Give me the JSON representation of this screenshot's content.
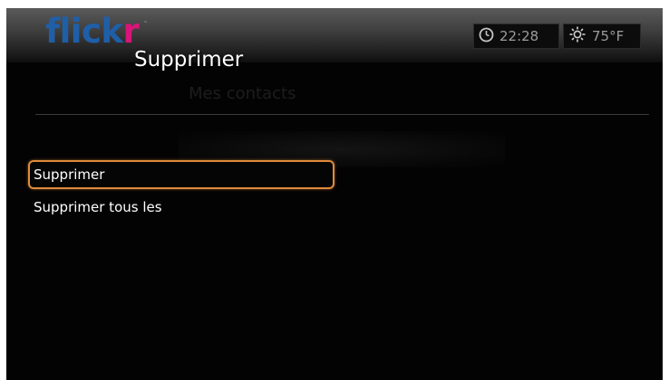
{
  "header": {
    "logo_text_main": "flick",
    "logo_text_tail": "r",
    "logo_tm": "™",
    "title": "Supprimer",
    "logo_colors": {
      "blue": "#1f5fa8",
      "pink": "#d8157a"
    }
  },
  "status": {
    "time": "22:28",
    "temperature": "75°F",
    "clock_icon": "clock-icon",
    "weather_icon": "sun-icon"
  },
  "background": {
    "ghost_label": "Mes contacts"
  },
  "menu": {
    "items": [
      {
        "label": "Supprimer",
        "selected": true
      },
      {
        "label": "Supprimer tous les",
        "selected": false
      }
    ],
    "highlight_color": "#e08a3c"
  }
}
